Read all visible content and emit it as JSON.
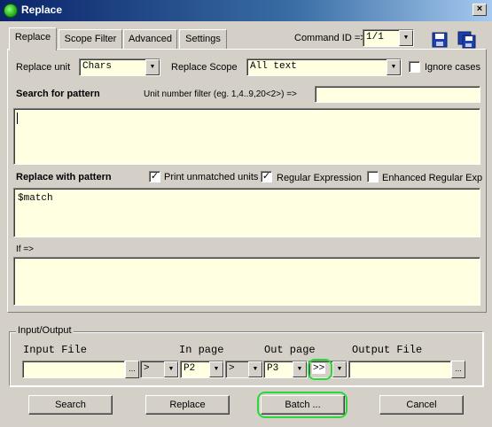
{
  "window": {
    "title": "Replace",
    "close_glyph": "×"
  },
  "tabs": [
    {
      "label": "Replace"
    },
    {
      "label": "Scope Filter"
    },
    {
      "label": "Advanced"
    },
    {
      "label": "Settings"
    }
  ],
  "command": {
    "label": "Command ID =>",
    "value": "1/1"
  },
  "replace_unit": {
    "label": "Replace unit",
    "value": "Chars"
  },
  "replace_scope": {
    "label": "Replace Scope",
    "value": "All text"
  },
  "ignore_cases": {
    "label": "Ignore cases",
    "checked": false
  },
  "search": {
    "label": "Search for pattern",
    "filter_label": "Unit number filter (eg. 1,4..9,20<2>) =>",
    "filter_value": "",
    "pattern": ""
  },
  "replace": {
    "label": "Replace with pattern",
    "pattern": "$match",
    "print_unmatched": {
      "label": "Print unmatched units",
      "checked": true
    },
    "regex": {
      "label": "Regular Expression",
      "checked": true
    },
    "enhanced": {
      "label": "Enhanced Regular Exp",
      "checked": false
    }
  },
  "if_label": "If =>",
  "if_value": "",
  "io": {
    "group_label": "Input/Output",
    "input_file_label": "Input File",
    "in_page_label": "In page",
    "out_page_label": "Out page",
    "output_file_label": "Output File",
    "input_file": "",
    "browse": "...",
    "in_op": ">",
    "in_page": "P2",
    "mid_op": ">",
    "out_page": "P3",
    "out_op": ">>",
    "output_file": "",
    "check_glyph": "✓",
    "dropdown_glyph": "▼"
  },
  "buttons": {
    "search": "Search",
    "replace": "Replace",
    "batch": "Batch ...",
    "cancel": "Cancel"
  }
}
